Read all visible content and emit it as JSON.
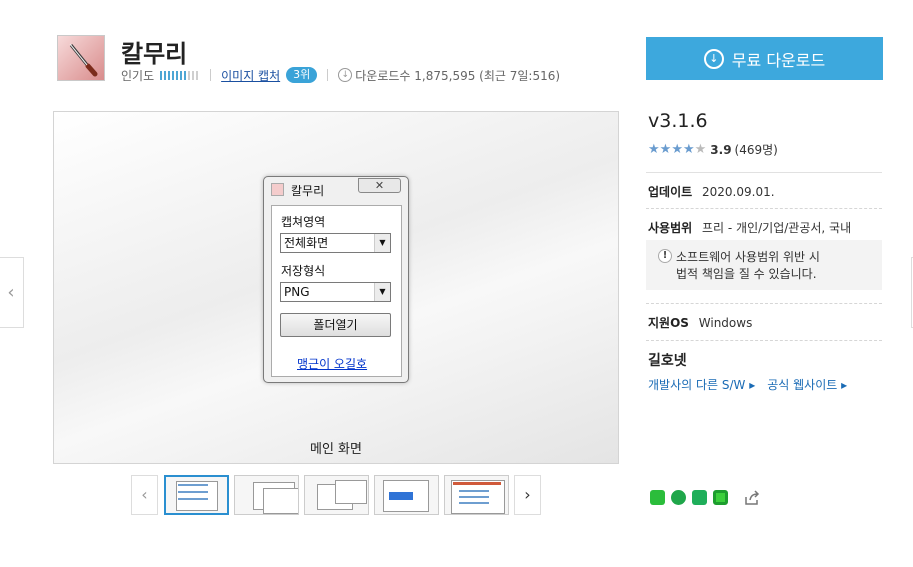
{
  "app": {
    "title": "칼무리",
    "popularity_label": "인기도",
    "popularity_level": 0.7,
    "category_link": "이미지 캡처",
    "rank_badge": "3위",
    "downloads_text": "다운로드수 1,875,595 (최근 7일:516)"
  },
  "screenshot": {
    "window_title": "칼무리",
    "close_glyph": "✕",
    "capture_area_label": "캡쳐영역",
    "capture_area_value": "전체화면",
    "save_format_label": "저장형식",
    "save_format_value": "PNG",
    "folder_button": "폴더열기",
    "link_text": "맹근이 오길호",
    "caption": "메인 화면"
  },
  "thumbnails": {
    "count": 5,
    "selected_index": 0,
    "prev_glyph": "‹",
    "next_glyph": "›"
  },
  "nav": {
    "left_glyph": "‹"
  },
  "sidebar": {
    "download_button": "무료 다운로드",
    "version": "v3.1.6",
    "rating_value": "3.9",
    "rating_count": "(469명)",
    "stars_filled": 4,
    "updated_label": "업데이트",
    "updated_value": "2020.09.01.",
    "license_label": "사용범위",
    "license_value": "프리 - 개인/기업/관공서, 국내",
    "notice_line1": "소프트웨어 사용범위 위반 시",
    "notice_line2": "법적 책임을 질 수 있습니다.",
    "os_label": "지원OS",
    "os_value": "Windows",
    "developer_name": "길호넷",
    "dev_other_link": "개발사의 다른 S/W ▸",
    "dev_site_link": "공식 웹사이트 ▸"
  },
  "colors": {
    "accent": "#3da8dd",
    "link": "#1a6bb5"
  }
}
